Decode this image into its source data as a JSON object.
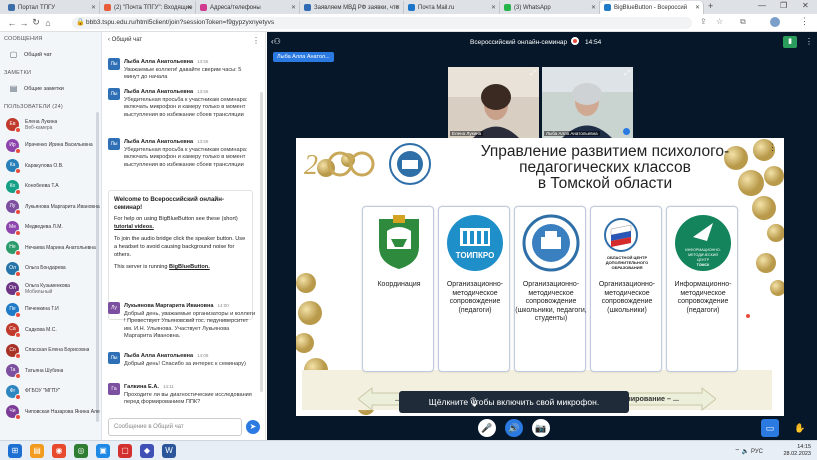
{
  "browser": {
    "tabs": [
      {
        "label": "Портал ТПГУ",
        "color": "#3b6ea8",
        "active": false
      },
      {
        "label": "(2) \"Почта ТПГУ\": Входящие",
        "color": "#e85d3a",
        "active": false
      },
      {
        "label": "Адреса/телефоны",
        "color": "#d13b8f",
        "active": false
      },
      {
        "label": "Заявляем МВД РФ заявки, что",
        "color": "#2f6bb5",
        "active": false
      },
      {
        "label": "Почта Mail.ru",
        "color": "#1a75c9",
        "active": false
      },
      {
        "label": "(3) WhatsApp",
        "color": "#25b44a",
        "active": false
      },
      {
        "label": "BigBlueButton - Всероссий",
        "color": "#1f7ac8",
        "active": true
      }
    ],
    "url": "bbb3.tspu.edu.ru/html5client/join?sessionToken=f9gypzyxnyetyvs"
  },
  "left": {
    "messages_title": "СООБЩЕНИЯ",
    "public_chat": "Общий чат",
    "notes_title": "ЗАМЕТКИ",
    "shared_notes": "Общие заметки",
    "users_title": "ПОЛЬЗОВАТЕЛИ (24)",
    "users": [
      {
        "initials": "Ев",
        "name": "Елена Лукина",
        "sub": "Веб-камера",
        "color": "#c0392b"
      },
      {
        "initials": "Ир",
        "name": "Ираченко Ирина Васильевна",
        "sub": "",
        "color": "#8e44ad"
      },
      {
        "initials": "Ка",
        "name": "Каракулова О.В.",
        "sub": "",
        "color": "#2980b9"
      },
      {
        "initials": "Ко",
        "name": "Конобеева Т.А",
        "sub": "",
        "color": "#16a085"
      },
      {
        "initials": "Лу",
        "name": "Лукьянова Маргарита Ивановна",
        "sub": "",
        "color": "#7d4fa0"
      },
      {
        "initials": "Ме",
        "name": "Медведева Л.М.",
        "sub": "",
        "color": "#8e44ad"
      },
      {
        "initials": "Не",
        "name": "Нечаева Марина Анатольевна",
        "sub": "",
        "color": "#2c9c6c"
      },
      {
        "initials": "Ол",
        "name": "Ольга Бондарева",
        "sub": "",
        "color": "#2574a9"
      },
      {
        "initials": "Ол",
        "name": "Ольга Кузьменкова",
        "sub": "Мобильный",
        "color": "#6c3483"
      },
      {
        "initials": "Пе",
        "name": "Печенкина Т.И",
        "sub": "",
        "color": "#1f7ac8"
      },
      {
        "initials": "Са",
        "name": "Садкова М.С.",
        "sub": "",
        "color": "#c0392b"
      },
      {
        "initials": "Сп",
        "name": "Спасская Елена Борисовна",
        "sub": "",
        "color": "#a93226"
      },
      {
        "initials": "Та",
        "name": "Татьяна Шубина",
        "sub": "",
        "color": "#7d4fa0"
      },
      {
        "initials": "Фг",
        "name": "ФГБОУ \"МГПУ\"",
        "sub": "",
        "color": "#2e86c1"
      },
      {
        "initials": "Чи",
        "name": "Чиповская Назарова Янина Алексеевна",
        "sub": "",
        "color": "#7d3c98"
      }
    ]
  },
  "chat": {
    "back_label": "Общий чат",
    "messages": [
      {
        "initials": "Лы",
        "name": "Лыба Алла Анатольевна",
        "time": "13:55",
        "text": "Уважаемые коллеги! давайте сверим часы: 5 минут до начала"
      },
      {
        "initials": "Лы",
        "name": "Лыба Алла Анатольевна",
        "time": "13:56",
        "text": "Убедительная просьба к участникам семинара: включать микрофон и камеру только в момент выступления во избежание сбоев трансляции"
      },
      {
        "initials": "Лы",
        "name": "Лыба Алла Анатольевна",
        "time": "13:59",
        "text": "Убедительная просьба к участникам семинара: включать микрофон и камеру только в момент выступления во избежание сбоев трансляции"
      },
      {
        "initials": "Лу",
        "name": "Лукьянова Маргарита Ивановна",
        "time": "14:00",
        "text": "Добрый день, уважаемые организаторы и коллеги ! Превествует Ульяновский гос. педуниверситет им. И.Н. Ульянова. Участвует Лукьянова Маргарита Ивановна."
      },
      {
        "initials": "Лы",
        "name": "Лыба Алла Анатольевна",
        "time": "14:09",
        "text": "Добрый день! Спасибо за интерес к семинару)"
      },
      {
        "initials": "Га",
        "name": "Галкина Е.А.",
        "time": "14:11",
        "text": "Проходите ли вы диагностические исследования перед формированием ППК?"
      }
    ],
    "welcome": {
      "title": "Welcome to Всероссийский онлайн-семинар!",
      "help": "For help on using BigBlueButton see these (short)",
      "link": "tutorial videos.",
      "audio": "To join the audio bridge click the speaker button. Use a headset to avoid causing background noise for others.",
      "server": "This server is running",
      "server_link": "BigBlueButton."
    },
    "input_placeholder": "Сообщение в Общий чат"
  },
  "main": {
    "presenter_label": "Лыба Алла Анатол...",
    "meeting_title": "Всероссийский онлайн-семинар",
    "timer": "14:54",
    "videos": [
      {
        "label": "Елена Лукина"
      },
      {
        "label": "Лыба Алла Анатольевна"
      }
    ],
    "slide": {
      "title_line1": "Управление развитием психолого-",
      "title_line2": "педагогических классов",
      "title_line3": "в Томской области",
      "cards": [
        {
          "logo": "tomsk-coat-of-arms",
          "text": "Координация"
        },
        {
          "logo": "toipkro-logo",
          "logo_text": "ТОИПКРО",
          "text": "Организационно-методическое сопровождение (педагоги)"
        },
        {
          "logo": "university-logo",
          "text": "Организационно-методическое сопровождение (школьники, педагоги, студенты)"
        },
        {
          "logo": "regional-center-logo",
          "logo_text": "ОБЛАСТНОЙ ЦЕНТР ДОПОЛНИТЕЛЬНОГО ОБРАЗОВАНИЯ",
          "text": "Организационно-методическое сопровождение (школьники)"
        },
        {
          "logo": "imc-tomsk-logo",
          "logo_text": "ИНФОРМАЦИОННО-МЕТОДИЧЕСКИЙ ЦЕНТР ТОМСК",
          "text": "Информационно-методическое сопровождение (педагоги)"
        }
      ],
      "arrow_text": "... – планирование – организация – исполнение – контроль – планирование – ..."
    },
    "tooltip": "Щёлкните  чтобы включить свой микрофон."
  },
  "taskbar": {
    "lang": "РУС",
    "time": "14:15",
    "date": "28.02.2023"
  }
}
